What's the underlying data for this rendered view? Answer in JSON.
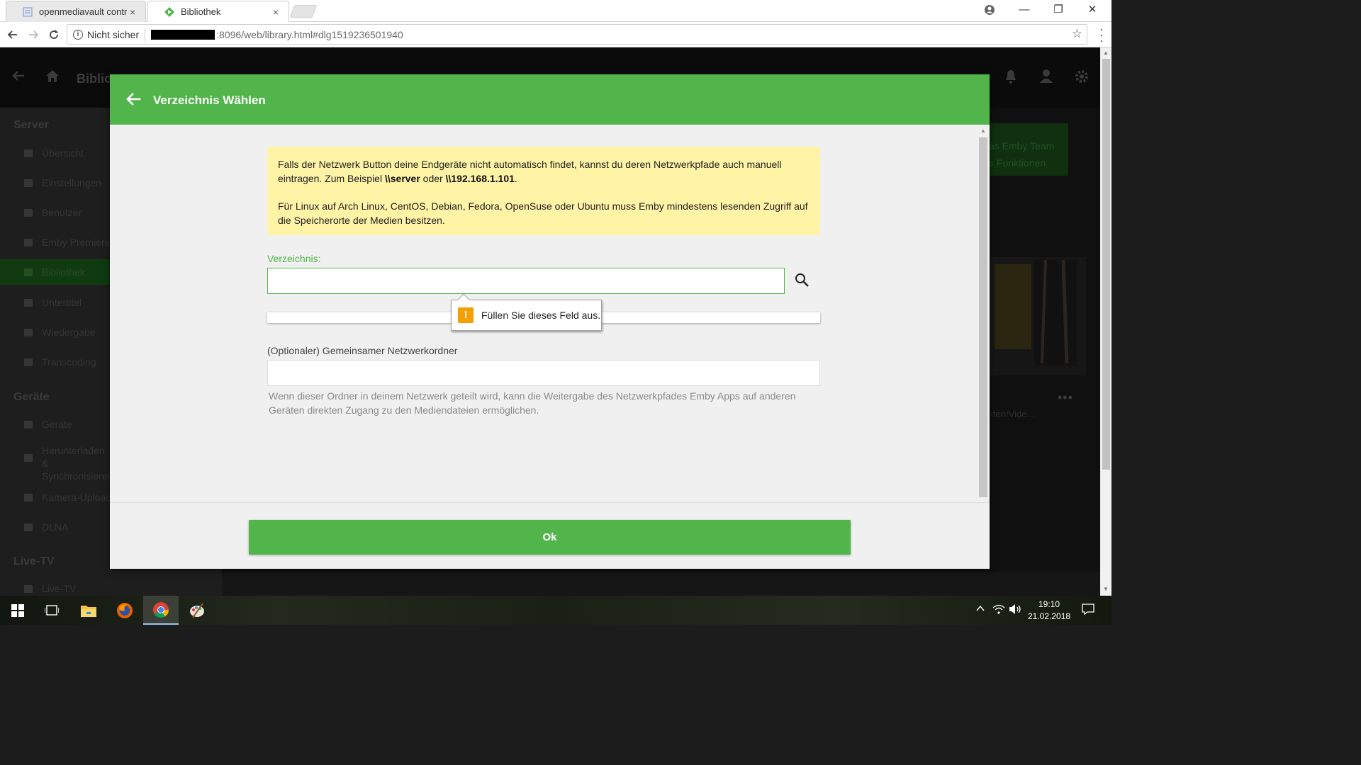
{
  "browser": {
    "tabs": [
      {
        "label": "openmediavault control p",
        "active": false
      },
      {
        "label": "Bibliothek",
        "active": true
      }
    ],
    "tab_close_glyph": "×",
    "security_label": "Nicht sicher",
    "url": ":8096/web/library.html#dlg1519236501940",
    "window_controls": {
      "minimize": "—",
      "maximize": "❐",
      "close": "✕"
    }
  },
  "page": {
    "header_title": "Biblio",
    "sidebar": {
      "sections": [
        {
          "heading": "Server",
          "items": [
            "Übersicht",
            "Einstellungen",
            "Benutzer",
            "Emby Premiere",
            "Bibliothek",
            "Untertitel",
            "Wiedergabe",
            "Transcoding"
          ]
        },
        {
          "heading": "Geräte",
          "items": [
            "Geräte",
            "Herunterladen & Synchronisieren",
            "Kamera-Upload",
            "DLNA"
          ]
        },
        {
          "heading": "Live-TV",
          "items": [
            "Live-TV"
          ]
        }
      ],
      "active_item": "Bibliothek"
    },
    "banner_lines": [
      "as Emby Team",
      "s Funktionen"
    ],
    "card_text": "iten/Vide...",
    "card_menu": "•••"
  },
  "dialog": {
    "title": "Verzeichnis Wählen",
    "info": {
      "p1_text": "Falls der Netzwerk Button deine Endgeräte nicht automatisch findet, kannst du deren Netzwerkpfade auch manuell eintragen. Zum Beispiel ",
      "p1_example1": "\\\\server",
      "p1_or": " oder ",
      "p1_example2": "\\\\192.168.1.101",
      "p1_end": ".",
      "p2": "Für Linux auf Arch Linux, CentOS, Debian, Fedora, OpenSuse oder Ubuntu muss Emby mindestens lesenden Zugriff auf die Speicherorte der Medien besitzen."
    },
    "directory_label": "Verzeichnis:",
    "directory_value": "",
    "validation_tooltip": "Füllen Sie dieses Feld aus.",
    "validation_icon": "!",
    "share_label": "(Optionaler) Gemeinsamer Netzwerkordner",
    "share_value": "",
    "share_help": "Wenn dieser Ordner in deinem Netzwerk geteilt wird, kann die Weitergabe des Netzwerkpfades Emby Apps auf anderen Geräten direkten Zugang zu den Mediendateien ermöglichen.",
    "ok_label": "Ok"
  },
  "taskbar": {
    "time": "19:10",
    "date": "21.02.2018"
  },
  "colors": {
    "accent": "#52b54b",
    "warning": "#fff3a6",
    "tooltip_icon": "#f5a000"
  }
}
